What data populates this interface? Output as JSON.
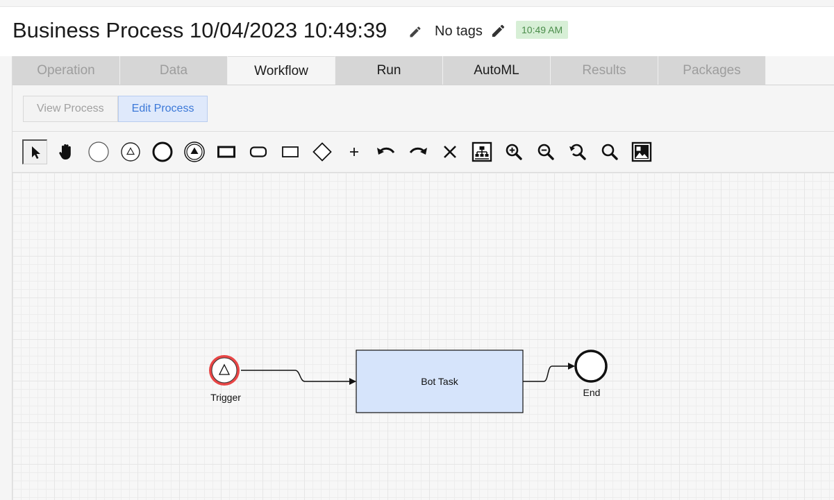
{
  "header": {
    "title": "Business Process 10/04/2023 10:49:39",
    "tags": "No tags",
    "time_badge": "10:49 AM"
  },
  "tabs": [
    {
      "label": "Operation",
      "state": "disabled"
    },
    {
      "label": "Data",
      "state": "disabled"
    },
    {
      "label": "Workflow",
      "state": "active"
    },
    {
      "label": "Run",
      "state": "enabled"
    },
    {
      "label": "AutoML",
      "state": "enabled"
    },
    {
      "label": "Results",
      "state": "disabled"
    },
    {
      "label": "Packages",
      "state": "disabled"
    }
  ],
  "view_buttons": {
    "view_process": "View Process",
    "edit_process": "Edit Process"
  },
  "toolbar": {
    "tools": [
      "pointer-icon",
      "hand-icon",
      "start-event-icon",
      "start-signal-event-icon",
      "end-event-icon",
      "end-signal-event-icon",
      "task-icon",
      "rounded-task-icon",
      "subprocess-icon",
      "gateway-icon",
      "add-icon",
      "undo-icon",
      "redo-icon",
      "delete-icon",
      "auto-layout-icon",
      "zoom-in-icon",
      "zoom-out-icon",
      "zoom-reset-icon",
      "zoom-fit-icon",
      "export-image-icon"
    ]
  },
  "diagram": {
    "nodes": {
      "trigger": "Trigger",
      "bot_task": "Bot Task",
      "end": "End"
    }
  },
  "colors": {
    "active_button": "#3b78d8",
    "time_badge_bg": "#d7efd6",
    "task_fill": "#d6e4fb",
    "trigger_ring": "#e54848"
  }
}
